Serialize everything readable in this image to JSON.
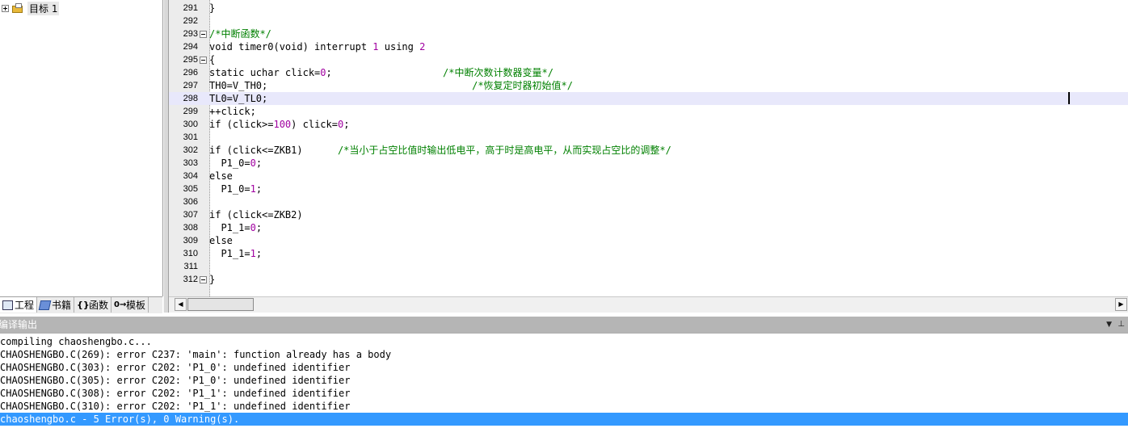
{
  "project": {
    "root_label": "目标 1",
    "tabs": [
      {
        "label": "工程",
        "icon": "project-icon"
      },
      {
        "label": "书籍",
        "icon": "book-icon"
      },
      {
        "label": "函数",
        "icon": "functions-icon"
      },
      {
        "label": "模板",
        "icon": "templates-icon"
      }
    ]
  },
  "editor": {
    "current_line": 298,
    "lines": [
      {
        "n": "291",
        "code": "}"
      },
      {
        "n": "292",
        "code": ""
      },
      {
        "n": "293",
        "fold": true,
        "comment": "/*中断函数*/"
      },
      {
        "n": "294",
        "code": "void timer0(void) interrupt ",
        "num": "1",
        "code2": " using ",
        "num2": "2"
      },
      {
        "n": "295",
        "fold": true,
        "code": "{"
      },
      {
        "n": "296",
        "code": "static uchar click=",
        "num": "0",
        "code2": ";                   ",
        "comment": "/*中断次数计数器变量*/"
      },
      {
        "n": "297",
        "code": "TH0=V_TH0;                                   ",
        "comment": "/*恢复定时器初始值*/"
      },
      {
        "n": "298",
        "code": "TL0=V_TL0;"
      },
      {
        "n": "299",
        "code": "++click;"
      },
      {
        "n": "300",
        "code": "if (click>=",
        "num": "100",
        "code2": ") click=",
        "num2": "0",
        "code3": ";"
      },
      {
        "n": "301",
        "code": ""
      },
      {
        "n": "302",
        "code": "if (click<=ZKB1)      ",
        "comment": "/*当小于占空比值时输出低电平，高于时是高电平，从而实现占空比的调整*/"
      },
      {
        "n": "303",
        "code": "  P1_0=",
        "num": "0",
        "code2": ";"
      },
      {
        "n": "304",
        "code": "else"
      },
      {
        "n": "305",
        "code": "  P1_0=",
        "num": "1",
        "code2": ";"
      },
      {
        "n": "306",
        "code": ""
      },
      {
        "n": "307",
        "code": "if (click<=ZKB2)"
      },
      {
        "n": "308",
        "code": "  P1_1=",
        "num": "0",
        "code2": ";"
      },
      {
        "n": "309",
        "code": "else"
      },
      {
        "n": "310",
        "code": "  P1_1=",
        "num": "1",
        "code2": ";"
      },
      {
        "n": "311",
        "code": ""
      },
      {
        "n": "312",
        "fold": true,
        "code": "}"
      }
    ]
  },
  "output": {
    "title": "编译输出",
    "lines": [
      "compiling chaoshengbo.c...",
      "CHAOSHENGBO.C(269): error C237: 'main': function already has a body",
      "CHAOSHENGBO.C(303): error C202: 'P1_0': undefined identifier",
      "CHAOSHENGBO.C(305): error C202: 'P1_0': undefined identifier",
      "CHAOSHENGBO.C(308): error C202: 'P1_1': undefined identifier",
      "CHAOSHENGBO.C(310): error C202: 'P1_1': undefined identifier",
      "chaoshengbo.c - 5 Error(s), 0 Warning(s)."
    ],
    "selected_index": 6
  },
  "colors": {
    "comment": "#008000",
    "number": "#a000a0",
    "selection": "#3399ff",
    "current_line": "#e8e8fb"
  }
}
